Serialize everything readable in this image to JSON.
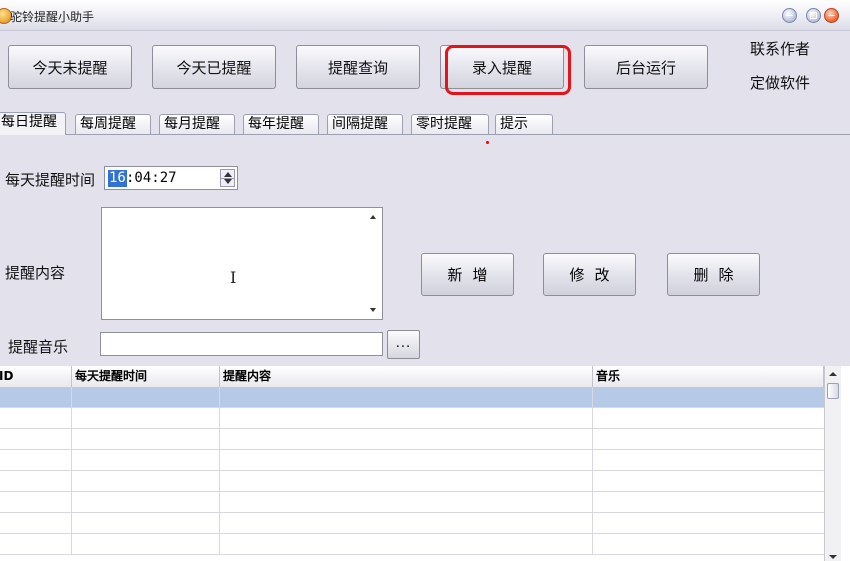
{
  "window": {
    "title": "驼铃提醒小助手"
  },
  "toolbar": {
    "btn1": "今天未提醒",
    "btn2": "今天已提醒",
    "btn3": "提醒查询",
    "btn4": "录入提醒",
    "btn5": "后台运行",
    "contact": "联系作者",
    "custom": "定做软件"
  },
  "tabs": [
    "每日提醒",
    "每周提醒",
    "每月提醒",
    "每年提醒",
    "间隔提醒",
    "零时提醒",
    "提示"
  ],
  "form": {
    "time_label": "每天提醒时间",
    "time_hour": "16",
    "time_rest": ":04:27",
    "content_label": "提醒内容",
    "music_label": "提醒音乐",
    "browse": "...",
    "add": "新增",
    "edit": "修改",
    "delete": "删除"
  },
  "table": {
    "columns": [
      "ID",
      "每天提醒时间",
      "提醒内容",
      "音乐"
    ]
  },
  "colors": {
    "accent": "#e3141a",
    "selection": "#b6c9e6"
  },
  "icons": {
    "app": "bell-icon",
    "ibeam": "text-cursor-icon"
  }
}
